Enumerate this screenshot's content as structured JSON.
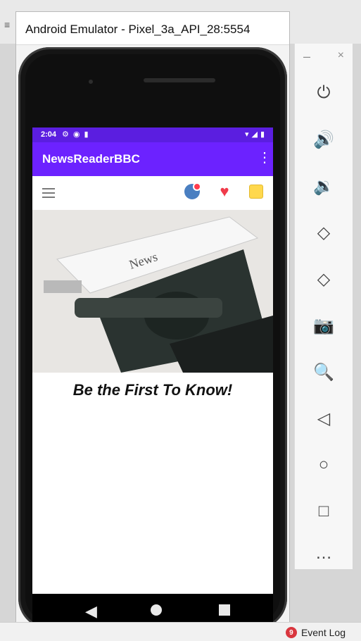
{
  "ide": {
    "event_log_label": "Event Log",
    "event_log_count": "9"
  },
  "emulator": {
    "window_title": "Android Emulator - Pixel_3a_API_28:5554"
  },
  "statusbar": {
    "time": "2:04"
  },
  "app": {
    "title": "NewsReaderBBC",
    "slogan": "Be the First To Know!"
  },
  "icons": {
    "hamburger": "menu-icon",
    "news": "globe-icon",
    "favorite": "heart-icon",
    "notes": "sticky-note-icon"
  }
}
